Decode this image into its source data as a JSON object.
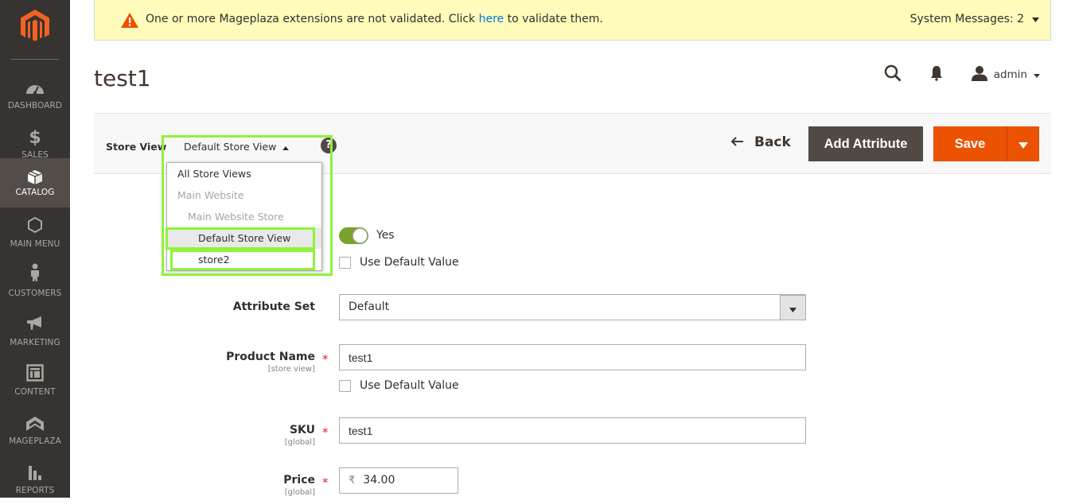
{
  "sidebar": {
    "logo": "magento-logo",
    "items": [
      {
        "label": "DASHBOARD",
        "icon": "dashboard-gauge-icon",
        "active": false
      },
      {
        "label": "SALES",
        "icon": "dollar-icon",
        "active": false
      },
      {
        "label": "CATALOG",
        "icon": "box-icon",
        "active": true
      },
      {
        "label": "MAIN MENU",
        "icon": "hexagon-icon",
        "active": false
      },
      {
        "label": "CUSTOMERS",
        "icon": "person-icon",
        "active": false
      },
      {
        "label": "MARKETING",
        "icon": "megaphone-icon",
        "active": false
      },
      {
        "label": "CONTENT",
        "icon": "layout-icon",
        "active": false
      },
      {
        "label": "MAGEPLAZA",
        "icon": "chevron-up-icon",
        "active": false
      },
      {
        "label": "REPORTS",
        "icon": "bar-chart-icon",
        "active": false
      }
    ]
  },
  "message_bar": {
    "text_before": "One or more Mageplaza extensions are not validated. Click ",
    "link": "here",
    "text_after": " to validate them.",
    "system_messages": "System Messages: 2"
  },
  "header": {
    "title": "test1",
    "user": "admin"
  },
  "actions": {
    "store_view_label": "Store View",
    "store_view_value": "Default Store View",
    "help": "?",
    "back": "Back",
    "add_attribute": "Add Attribute",
    "save": "Save"
  },
  "store_dropdown": {
    "items": [
      {
        "label": "All Store Views",
        "type": "option"
      },
      {
        "label": "Main Website",
        "type": "group"
      },
      {
        "label": "Main Website Store",
        "type": "group"
      },
      {
        "label": "Default Store View",
        "type": "option",
        "selected": true
      },
      {
        "label": "store2",
        "type": "option"
      }
    ]
  },
  "form": {
    "enable": {
      "value": "Yes",
      "on": true,
      "use_default": "Use Default Value"
    },
    "attribute_set": {
      "label": "Attribute Set",
      "value": "Default"
    },
    "product_name": {
      "label": "Product Name",
      "scope": "[store view]",
      "value": "test1",
      "required": "*",
      "use_default": "Use Default Value"
    },
    "sku": {
      "label": "SKU",
      "scope": "[global]",
      "value": "test1",
      "required": "*"
    },
    "price": {
      "label": "Price",
      "scope": "[global]",
      "currency": "₹",
      "value": "34.00",
      "required": "*"
    }
  },
  "colors": {
    "sidebar_bg": "#373330",
    "accent_orange": "#eb5202",
    "highlight_green": "#8ef33b",
    "toggle_on": "#79a22e",
    "message_bg": "#fffbbb"
  }
}
